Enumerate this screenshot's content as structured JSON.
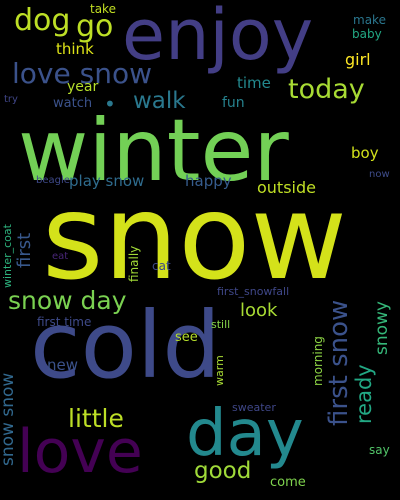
{
  "words": [
    {
      "text": "snow",
      "color": "#d4e21a"
    },
    {
      "text": "winter",
      "color": "#73d056"
    },
    {
      "text": "cold",
      "color": "#3e4a89"
    },
    {
      "text": "enjoy",
      "color": "#433e85"
    },
    {
      "text": "day",
      "color": "#23898e"
    },
    {
      "text": "love",
      "color": "#440154"
    },
    {
      "text": "love snow",
      "color": "#3b528b"
    },
    {
      "text": "dog",
      "color": "#bddf26"
    },
    {
      "text": "go",
      "color": "#bddf26"
    },
    {
      "text": "walk",
      "color": "#2a788e"
    },
    {
      "text": "today",
      "color": "#a8db34"
    },
    {
      "text": "snow day",
      "color": "#7ad151"
    },
    {
      "text": "first snow",
      "color": "#3b528b"
    },
    {
      "text": "little",
      "color": "#bddf26"
    },
    {
      "text": "good",
      "color": "#a0da39"
    },
    {
      "text": "ready",
      "color": "#22a884"
    },
    {
      "text": "snowy",
      "color": "#35b779"
    },
    {
      "text": "snow snow",
      "color": "#31688e"
    },
    {
      "text": "play snow",
      "color": "#2f6c8e"
    },
    {
      "text": "happy",
      "color": "#365c8d"
    },
    {
      "text": "outside",
      "color": "#c0df25"
    },
    {
      "text": "first",
      "color": "#38588c"
    },
    {
      "text": "look",
      "color": "#a8db34"
    },
    {
      "text": "new",
      "color": "#3b528b"
    },
    {
      "text": "girl",
      "color": "#fde725"
    },
    {
      "text": "year",
      "color": "#b5de2b"
    },
    {
      "text": "fun",
      "color": "#26828e"
    },
    {
      "text": "time",
      "color": "#23898e"
    },
    {
      "text": "boy",
      "color": "#d2e21b"
    },
    {
      "text": "think",
      "color": "#dde318"
    },
    {
      "text": "watch",
      "color": "#3b528b"
    },
    {
      "text": "take",
      "color": "#c2df23"
    },
    {
      "text": "make",
      "color": "#2a768e"
    },
    {
      "text": "baby",
      "color": "#22a884"
    },
    {
      "text": "try",
      "color": "#404688"
    },
    {
      "text": "now",
      "color": "#3e4c8a"
    },
    {
      "text": "beagle",
      "color": "#3e4989"
    },
    {
      "text": "winter_coat",
      "color": "#2db27d"
    },
    {
      "text": "finally",
      "color": "#a2da37"
    },
    {
      "text": "cat",
      "color": "#3e4a89"
    },
    {
      "text": "eat",
      "color": "#482677"
    },
    {
      "text": "first_snowfall",
      "color": "#3f4788"
    },
    {
      "text": "first time",
      "color": "#3e4a89"
    },
    {
      "text": "see",
      "color": "#b5de2b"
    },
    {
      "text": "still",
      "color": "#86d549"
    },
    {
      "text": "warm",
      "color": "#a8db34"
    },
    {
      "text": "morning",
      "color": "#8ed645"
    },
    {
      "text": "sweater",
      "color": "#3f4788"
    },
    {
      "text": "say",
      "color": "#52c569"
    },
    {
      "text": "come",
      "color": "#7fd34e"
    }
  ]
}
